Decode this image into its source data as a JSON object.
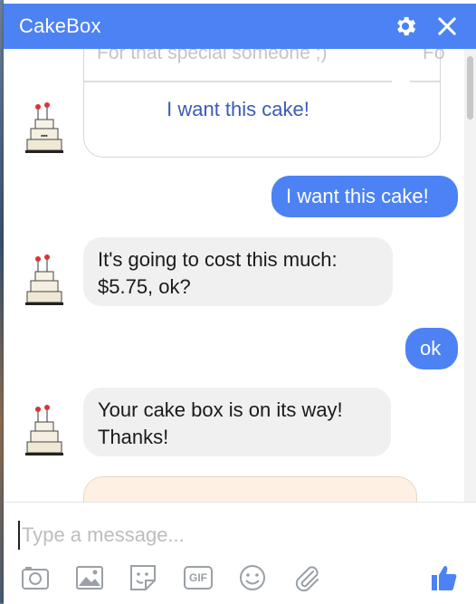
{
  "header": {
    "title": "CakeBox"
  },
  "card": {
    "subtitle": "For that special someone ;)",
    "peek_text": "Fo",
    "button_label": "I want this cake!"
  },
  "messages": [
    {
      "sender": "user",
      "text": "I want this cake!"
    },
    {
      "sender": "bot",
      "text": "It's going to cost this much: $5.75, ok?"
    },
    {
      "sender": "user",
      "text": "ok"
    },
    {
      "sender": "bot",
      "text": "Your cake box is on its way! Thanks!"
    }
  ],
  "composer": {
    "placeholder": "Type a message...",
    "tools": [
      "camera-icon",
      "image-icon",
      "sticker-icon",
      "gif-icon",
      "emoji-icon",
      "attachment-icon",
      "thumbs-up-icon"
    ],
    "gif_label": "GIF"
  },
  "colors": {
    "accent": "#4c82f4",
    "incoming_bubble": "#f0f0f0",
    "card_link": "#3b5bb7"
  }
}
